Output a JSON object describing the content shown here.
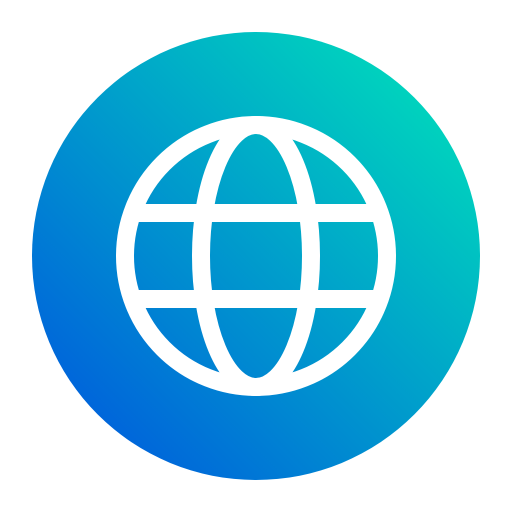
{
  "app_icon": {
    "icon": "globe-icon",
    "colors": {
      "gradient_start": "#0050E0",
      "gradient_end": "#00E8B8",
      "glyph": "#FFFFFF",
      "background": "#FFFFFF"
    }
  }
}
